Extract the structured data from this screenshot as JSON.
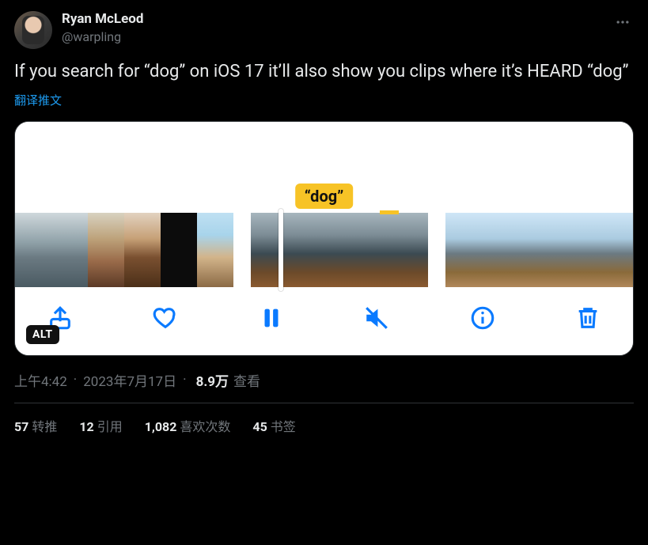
{
  "author": {
    "display_name": "Ryan McLeod",
    "handle": "@warpling"
  },
  "content_text": "If you search for “dog” on iOS 17 it’ll also show you clips where it’s HEARD “dog”",
  "translate_label": "翻译推文",
  "media": {
    "search_badge": "“dog”",
    "alt_badge": "ALT",
    "action_icons": {
      "share": "share-icon",
      "like": "heart-icon",
      "pause": "pause-icon",
      "mute": "mute-icon",
      "info": "info-icon",
      "trash": "trash-icon"
    }
  },
  "meta": {
    "time": "上午4:42",
    "date": "2023年7月17日",
    "views_number": "8.9万",
    "views_label": "查看"
  },
  "stats": {
    "retweets": {
      "count": "57",
      "label": "转推"
    },
    "quotes": {
      "count": "12",
      "label": "引用"
    },
    "likes": {
      "count": "1,082",
      "label": "喜欢次数"
    },
    "bookmarks": {
      "count": "45",
      "label": "书签"
    }
  }
}
